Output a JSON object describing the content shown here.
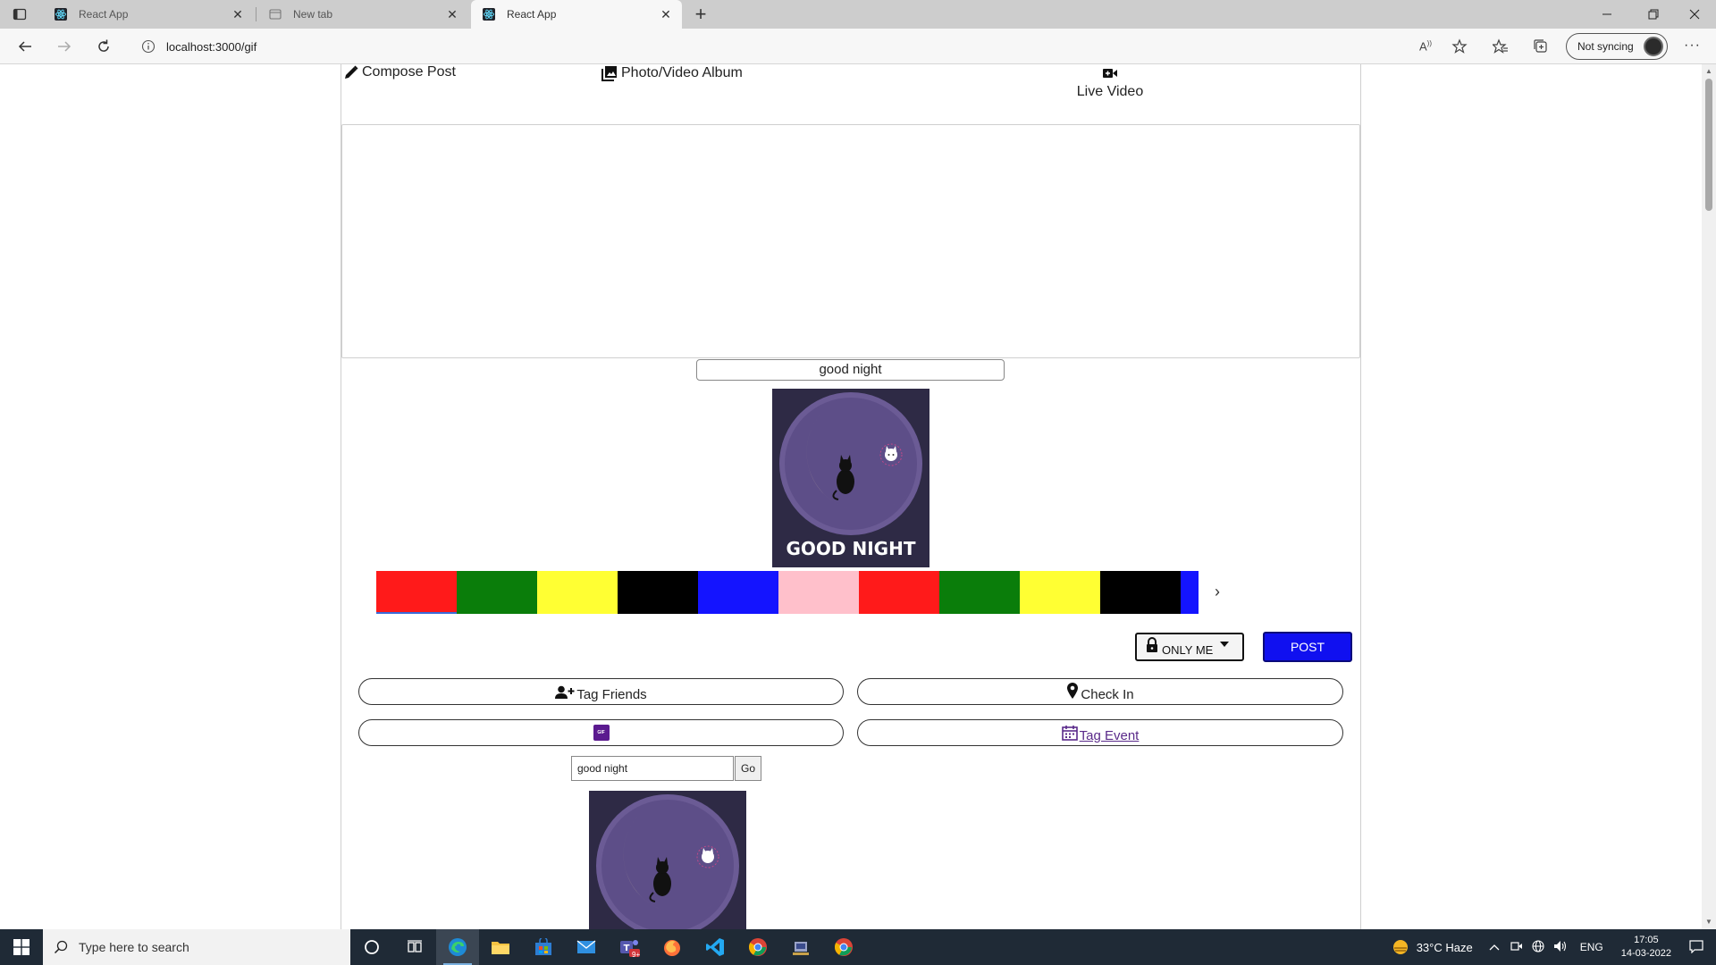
{
  "browser": {
    "tabs": [
      {
        "label": "React App",
        "active": false
      },
      {
        "label": "New tab",
        "active": false
      },
      {
        "label": "React App",
        "active": true
      }
    ],
    "new_tab_symbol": "+",
    "url": "localhost:3000/gif",
    "sync_label": "Not syncing",
    "window_controls": [
      "minimize-icon",
      "restore-icon",
      "close-icon"
    ]
  },
  "composer": {
    "options": [
      {
        "label": "Compose Post",
        "icon": "pencil-icon"
      },
      {
        "label": "Photo/Video Album",
        "icon": "photo-album-icon"
      },
      {
        "label": "Live Video",
        "icon": "video-camera-icon"
      }
    ],
    "caption_value": "good night",
    "gif_caption": "GOOD NIGHT",
    "swatch_colors": [
      "#ff1a1a",
      "#0a7d0a",
      "#ffff33",
      "#000000",
      "#1414ff",
      "#ffc0cb",
      "#ff1a1a",
      "#0a7d0a",
      "#ffff33",
      "#000000",
      "#1414ff"
    ],
    "swatch_next_symbol": "›",
    "privacy_label": "ONLY ME",
    "post_label": "POST",
    "tag_friends_label": "Tag Friends",
    "check_in_label": "Check In",
    "tag_event_label": "Tag Event",
    "gif_badge": "GIF",
    "gif_search_value": "good night",
    "go_label": "Go"
  },
  "taskbar": {
    "search_placeholder": "Type here to search",
    "weather": "33°C  Haze",
    "language": "ENG",
    "time": "17:05",
    "date": "14-03-2022",
    "notification_badge": "9+"
  },
  "colors": {
    "post_button": "#1010f0",
    "taskbar": "#1f2a36",
    "gif_background": "#2e2a45"
  }
}
